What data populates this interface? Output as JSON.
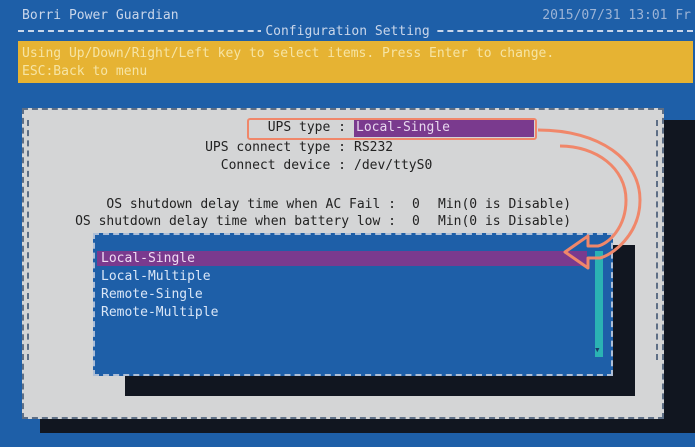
{
  "header": {
    "app_title": "Borri Power Guardian",
    "datetime": "2015/07/31 13:01 Fr",
    "screen_title": "Configuration Setting"
  },
  "help": {
    "line1": "Using Up/Down/Right/Left key to select items. Press Enter to change.",
    "line2": "ESC:Back to menu"
  },
  "settings": {
    "ups_type": {
      "label": "UPS type :",
      "value": "Local-Single"
    },
    "ups_connect_type": {
      "label": "UPS connect type :",
      "value": "RS232"
    },
    "connect_device": {
      "label": "Connect device :",
      "value": "/dev/ttyS0"
    },
    "ac_fail_delay": {
      "label": "OS shutdown delay time when AC Fail :",
      "value": "0",
      "unit": "Min(0 is Disable)"
    },
    "battery_low_delay": {
      "label": "OS shutdown delay time when battery low :",
      "value": "0",
      "unit": "Min(0 is Disable)"
    }
  },
  "ups_type_options": [
    "Local-Single",
    "Local-Multiple",
    "Remote-Single",
    "Remote-Multiple"
  ],
  "selected_option": "Local-Single",
  "colors": {
    "background": "#1e5fa8",
    "help_bar": "#e6b333",
    "selection": "#7a3a8e",
    "annotation": "#f0876a"
  }
}
